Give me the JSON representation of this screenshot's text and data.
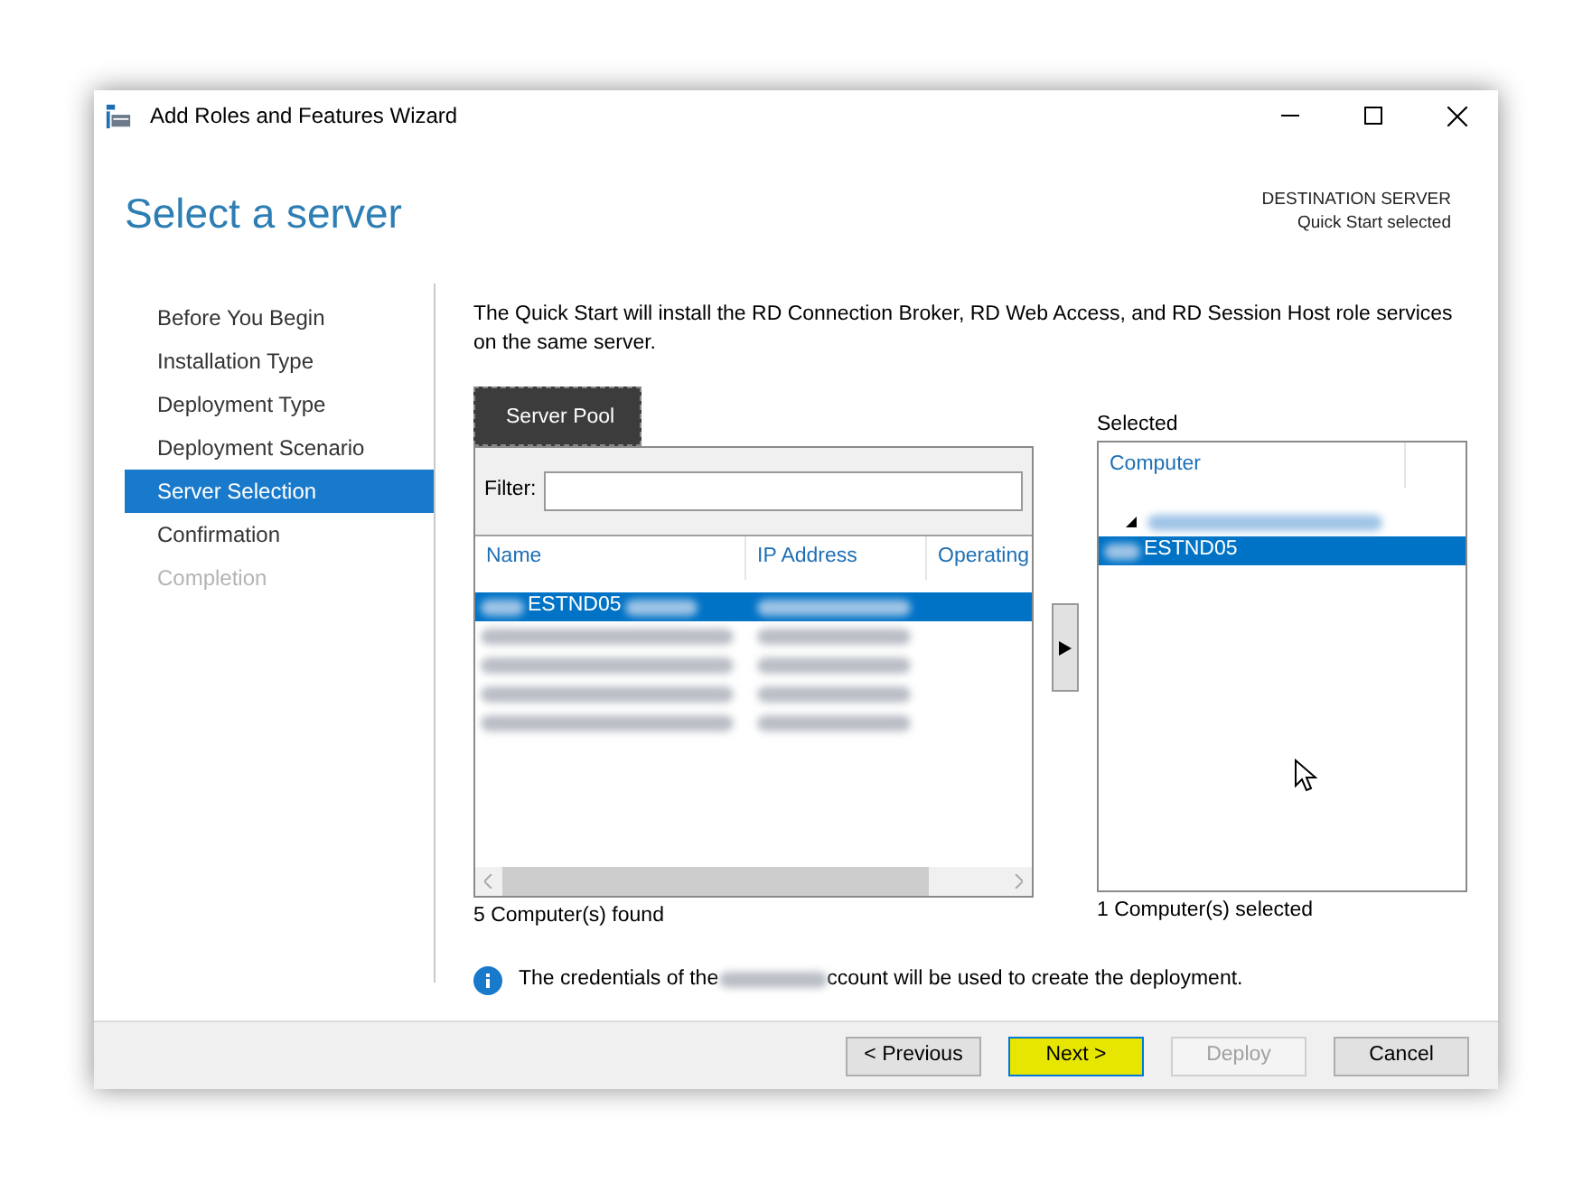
{
  "window": {
    "title": "Add Roles and Features Wizard"
  },
  "header": {
    "title": "Select a server",
    "destination_label": "DESTINATION SERVER",
    "destination_value": "Quick Start selected"
  },
  "steps": [
    {
      "label": "Before You Begin",
      "selected": false,
      "disabled": false
    },
    {
      "label": "Installation Type",
      "selected": false,
      "disabled": false
    },
    {
      "label": "Deployment Type",
      "selected": false,
      "disabled": false
    },
    {
      "label": "Deployment Scenario",
      "selected": false,
      "disabled": false
    },
    {
      "label": "Server Selection",
      "selected": true,
      "disabled": false
    },
    {
      "label": "Confirmation",
      "selected": false,
      "disabled": false
    },
    {
      "label": "Completion",
      "selected": false,
      "disabled": true
    }
  ],
  "description": "The Quick Start will install the RD Connection Broker, RD Web Access, and RD Session Host role services on the same server.",
  "server_pool": {
    "tab": "Server Pool",
    "filter_label": "Filter:",
    "columns": [
      "Name",
      "IP Address",
      "Operating"
    ],
    "rows": [
      {
        "name": "ESTND05",
        "selected": true
      },
      {
        "selected": false
      },
      {
        "selected": false
      },
      {
        "selected": false
      },
      {
        "selected": false
      }
    ],
    "count": "5 Computer(s) found"
  },
  "selected": {
    "label": "Selected",
    "column": "Computer",
    "tree": [
      {
        "expanded": true,
        "children": [
          {
            "name": "ESTND05",
            "selected": true
          }
        ]
      }
    ],
    "count": "1 Computer(s) selected"
  },
  "info": {
    "before": "The credentials of the",
    "after": "ccount will be used to create the deployment."
  },
  "buttons": [
    {
      "label": "< Previous",
      "disabled": false,
      "highlighted": false
    },
    {
      "label": "Next >",
      "disabled": false,
      "highlighted": true
    },
    {
      "label": "Deploy",
      "disabled": true,
      "highlighted": false
    },
    {
      "label": "Cancel",
      "disabled": false,
      "highlighted": false
    }
  ]
}
